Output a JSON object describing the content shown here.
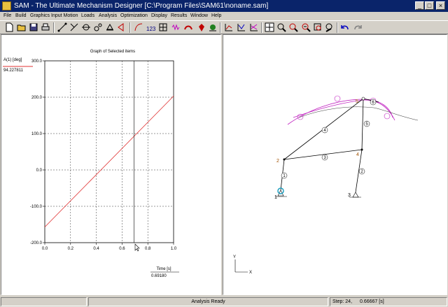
{
  "window": {
    "title": "SAM - The Ultimate Mechanism Designer [C:\\Program Files\\SAM61\\noname.sam]",
    "minimize": "_",
    "maximize": "□",
    "close": "×"
  },
  "menu": [
    "File",
    "Build",
    "Graphics",
    "Input Motion",
    "Loads",
    "Analysis",
    "Optimization",
    "Display",
    "Results",
    "Window",
    "Help"
  ],
  "toolbar_icons": [
    "new-icon",
    "open-icon",
    "save-icon",
    "print-icon",
    "node-icon",
    "beam-icon",
    "slider-icon",
    "gear-icon",
    "support-icon",
    "force-icon",
    "path-icon",
    "numbering-icon",
    "grid-icon",
    "spring-icon",
    "damper-icon",
    "mass-icon",
    "friction-icon",
    "graph-icon",
    "graph2-icon",
    "graph3-icon",
    "cursor-icon",
    "zoom-icon",
    "zoom-in-icon",
    "zoom-out-icon",
    "zoom-fit-icon",
    "pan-icon",
    "undo-icon",
    "redo-icon"
  ],
  "graph": {
    "title": "Graph of Selected items",
    "legend_label": "A(1) [deg]",
    "legend_value": "94.227811",
    "x_axis_title": "Time [s]",
    "x_readout": "0.69180",
    "cursor_time": 0.6918
  },
  "chart_data": {
    "type": "line",
    "title": "Graph of Selected items",
    "xlabel": "Time [s]",
    "ylabel": "",
    "xlim": [
      0.0,
      1.0
    ],
    "ylim": [
      -200.0,
      300.0
    ],
    "x_ticks": [
      "0.0",
      "0.2",
      "0.4",
      "0.6",
      "0.8",
      "1.0"
    ],
    "y_ticks": [
      "-200.0",
      "-100.0",
      "0.0",
      "100.0",
      "200.0",
      "300.0"
    ],
    "grid": true,
    "series": [
      {
        "name": "A(1) [deg]",
        "color": "#e03030",
        "x": [
          0.0,
          1.0
        ],
        "y": [
          -157.0,
          203.0
        ]
      }
    ]
  },
  "mechanism": {
    "node_labels": [
      "1",
      "2",
      "3",
      "4",
      "5"
    ],
    "element_labels": [
      "1",
      "2",
      "3",
      "4",
      "5",
      "6"
    ],
    "axis_x": "X",
    "axis_y": "Y"
  },
  "status": {
    "message": "Analysis Ready",
    "step": "Step: 24,",
    "time": "0.66667 [s]"
  },
  "colors": {
    "titlebar": "#0a246a",
    "curve": "#e03030",
    "path": "#c020c0",
    "accent_node": "#20a0c0"
  }
}
